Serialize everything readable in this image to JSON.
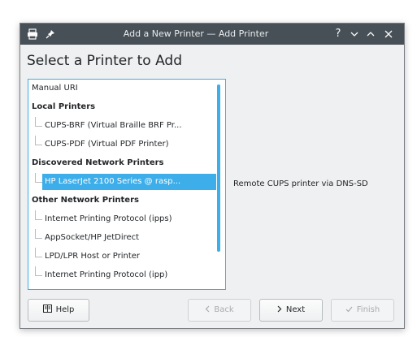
{
  "window": {
    "title": "Add a New Printer — Add Printer",
    "titlebar_icons": [
      "printer-icon",
      "pin-icon"
    ],
    "titlebar_controls": [
      "help-icon",
      "minimize-icon",
      "maximize-icon",
      "close-icon"
    ]
  },
  "heading": "Select a Printer to Add",
  "list": {
    "items": [
      {
        "label": "Manual URI",
        "type": "item"
      },
      {
        "label": "Local Printers",
        "type": "group"
      },
      {
        "label": "CUPS-BRF (Virtual Braille BRF Pr...",
        "type": "child"
      },
      {
        "label": "CUPS-PDF (Virtual PDF Printer)",
        "type": "child"
      },
      {
        "label": "Discovered Network Printers",
        "type": "group"
      },
      {
        "label": "HP LaserJet 2100 Series @ rasp...",
        "type": "child",
        "selected": true
      },
      {
        "label": "Other Network Printers",
        "type": "group"
      },
      {
        "label": "Internet Printing Protocol (ipps)",
        "type": "child"
      },
      {
        "label": "AppSocket/HP JetDirect",
        "type": "child"
      },
      {
        "label": "LPD/LPR Host or Printer",
        "type": "child"
      },
      {
        "label": "Internet Printing Protocol (ipp)",
        "type": "child"
      }
    ]
  },
  "description": "Remote CUPS printer via DNS-SD",
  "buttons": {
    "help": {
      "label": "Help",
      "icon": "help-book-icon"
    },
    "back": {
      "label": "Back",
      "icon": "chevron-left-icon",
      "disabled": true
    },
    "next": {
      "label": "Next",
      "icon": "chevron-right-icon"
    },
    "finish": {
      "label": "Finish",
      "icon": "checkmark-icon",
      "disabled": true
    }
  },
  "colors": {
    "accent": "#3daee9",
    "titlebar": "#475057",
    "window_bg": "#eff0f1"
  }
}
